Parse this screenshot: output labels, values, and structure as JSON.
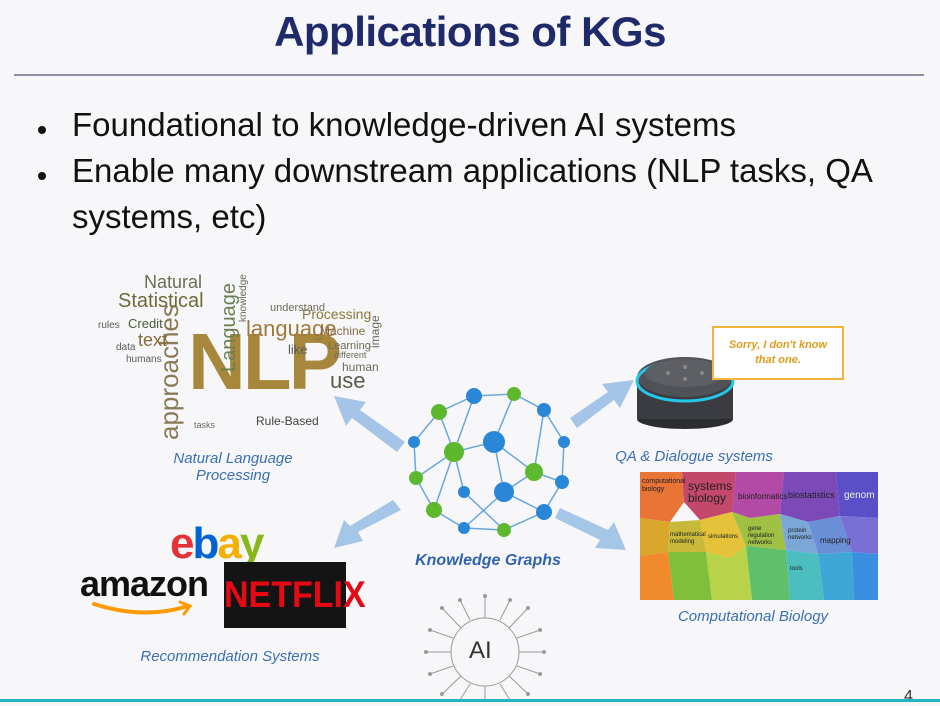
{
  "slide": {
    "title": "Applications of KGs",
    "bullets": [
      "Foundational to knowledge-driven AI systems",
      "Enable many downstream applications (NLP tasks, QA systems, etc)"
    ],
    "page_number": "4"
  },
  "panels": {
    "nlp": {
      "caption_line1": "Natural Language",
      "caption_line2": "Processing",
      "words": [
        "NLP",
        "approaches",
        "Language",
        "Statistical",
        "Natural",
        "language",
        "text",
        "use",
        "human",
        "Processing",
        "Machine",
        "Learning",
        "Rule-Based",
        "Credit",
        "rules",
        "like",
        "data",
        "humans",
        "image",
        "understand",
        "knowledge",
        "different",
        "tasks"
      ]
    },
    "qa": {
      "caption": "QA & Dialogue systems",
      "bubble_line1": "Sorry, I don't know",
      "bubble_line2": "that one."
    },
    "kg": {
      "caption": "Knowledge Graphs"
    },
    "biology": {
      "caption": "Computational Biology",
      "cells": [
        "computational biology",
        "systems biology",
        "bioinformatics",
        "biostatistics",
        "genom",
        "mathematical modeling",
        "simulations",
        "gene regulation networks",
        "protein networks",
        "mapping",
        "tools"
      ]
    },
    "recommendation": {
      "caption": "Recommendation Systems",
      "ebay_letters": [
        "e",
        "b",
        "a",
        "y"
      ],
      "amazon": "amazon",
      "netflix": "NETFLIX"
    },
    "ai": {
      "label": "AI"
    }
  },
  "colors": {
    "title": "#1f2a6b",
    "caption": "#3a6fb5",
    "arrow": "#9cc0e6",
    "kg_green": "#5db82e",
    "kg_blue": "#2a86d6",
    "ebay": [
      "#e53238",
      "#0064d2",
      "#f5af02",
      "#86b817"
    ],
    "netflix_red": "#e50914",
    "amazon_smile": "#ff9900",
    "bubble_border": "#f2b43a"
  }
}
